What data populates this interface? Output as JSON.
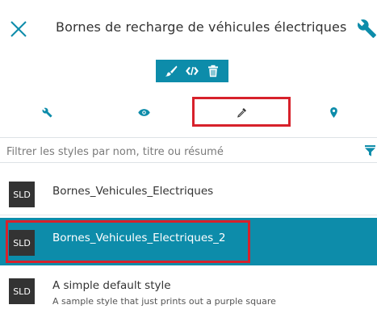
{
  "header": {
    "title": "Bornes de recharge de véhicules électriques"
  },
  "toolbar": {
    "buttons": [
      "brush-icon",
      "code-icon",
      "trash-icon"
    ]
  },
  "tabs": [
    {
      "icon": "wrench-icon",
      "active": false
    },
    {
      "icon": "eye-icon",
      "active": false
    },
    {
      "icon": "eyedropper-icon",
      "active": true
    },
    {
      "icon": "map-pin-icon",
      "active": false
    }
  ],
  "filter": {
    "placeholder": "Filtrer les styles par nom, titre ou résumé",
    "value": ""
  },
  "styles": [
    {
      "badge": "SLD",
      "name": "Bornes_Vehicules_Electriques",
      "description": "",
      "selected": false
    },
    {
      "badge": "SLD",
      "name": "Bornes_Vehicules_Electriques_2",
      "description": "",
      "selected": true
    },
    {
      "badge": "SLD",
      "name": "A simple default style",
      "description": "A sample style that just prints out a purple square",
      "selected": false
    }
  ],
  "colors": {
    "accent": "#0d8caa",
    "highlight": "#d7212b",
    "badge": "#333333"
  }
}
